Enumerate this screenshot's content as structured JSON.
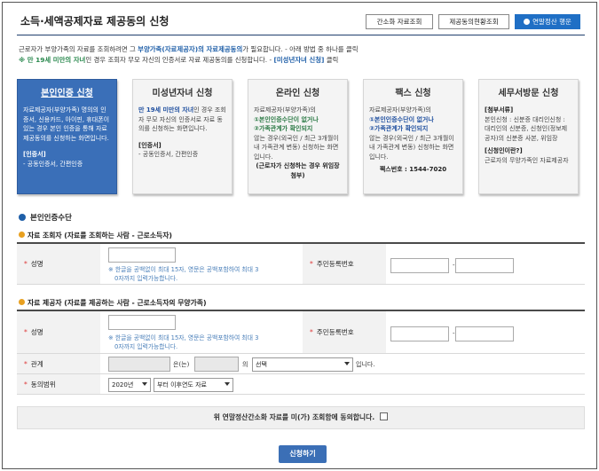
{
  "page": {
    "title": "소득·세액공제자료 제공동의 신청",
    "buttons": {
      "deduction_lookup": "간소화 자료조회",
      "consent_status": "제공동의현황조회",
      "yearend_help": "연말정산 행운"
    },
    "intro_line1_pre": "근로자가 부양가족의 자료를 조회하려면 그 ",
    "intro_line1_hl": "부양가족(자료제공자)의 자료제공동의",
    "intro_line1_post": "가 필요합니다. - 아래 방법 중 하나를 클릭",
    "intro_line2_green": "※ 만 19세 미만의 자녀",
    "intro_line2_mid": "인 경우 조회자 무모 자신의 인증서로 자료 제공동의를 신청합니다. - ",
    "intro_line2_hl": "[미성년자녀 신청]",
    "intro_line2_post": " 클릭"
  },
  "cards": [
    {
      "title": "본인인증 신청",
      "body": "자료제공자(부양가족) 명의의 인증서, 신용카드, 아이핀, 휴대폰이 있는 경우 본인 인증을 통해 자료제공동의를 신청하는 화면입니다.",
      "footer_title": "[인증서]",
      "footer_body": "- 공동인증서, 간편인증"
    },
    {
      "title": "미성년자녀 신청",
      "body_hl": "만 19세 미만의 자녀",
      "body": "인 경우 조회자 무모 자신의 인증서로 자료 동의를 신청하는 화면입니다.",
      "footer_title": "[인증서]",
      "footer_body": "- 공동인증서, 간편인증"
    },
    {
      "title": "온라인 신청",
      "body_pre": "자료제공자(부양가족)의",
      "body_b1": "①본인인증수단이 없거나",
      "body_b2": "②가족관계가 확인되지",
      "body_mid": "않는 경우(외국인 / 최근 3개월이내 가족관계 변동) 신청하는 화면입니다.",
      "footer": "(근로자가 신청하는 경우 위임장 첨부)"
    },
    {
      "title": "팩스 신청",
      "body_pre": "자료제공자(부양가족)의",
      "body_b1": "①본인인증수단이 없거나",
      "body_b2": "②가족관계가 확인되지",
      "body_mid": "않는 경우(외국인 / 최근 3개월이내 가족관계 변동) 신청하는 화면입니다.",
      "footer": "팩스번호 : 1544-7020"
    },
    {
      "title": "세무서방문 신청",
      "doc_title": "[첨부서류]",
      "doc_body": "본인신청 : 신분증 대리인신청 : 대리인의 신분증, 신청인(정보제공자)의 신분증 사본, 위임장",
      "who_title": "[신청인이란?]",
      "who_body": "근로자의 무양가족인 자료제공자"
    }
  ],
  "section": {
    "title": "본인인증수단",
    "viewer_title": "자료 조회자 (자료를 조회하는 사람 - 근로소득자)",
    "provider_title": "자료 제공자 (자료를 제공하는 사람 - 근로소득자의 무양가족)"
  },
  "form": {
    "name_label": "성명",
    "rrn_label": "주민등록번호",
    "name_hint_line1": "※ 한글을 공백없이 최대 15자, 영문은 공백포함하여 최대 3",
    "name_hint_line2": "0자까지 입력가능합니다.",
    "rrn_dash": "-",
    "relation_label": "관계",
    "relation_eun": "은(는)",
    "relation_ui": "의",
    "relation_select": "선택",
    "relation_end": "입니다.",
    "consent_range_label": "동의범위",
    "year_select": "2020년",
    "range_select": "부터 이후연도 자료"
  },
  "agreement": {
    "text": "위 연말정산간소화 자료를 미(가) 조회함에 동의합니다."
  },
  "submit": {
    "label": "신청하기"
  },
  "colors": {
    "primary": "#3a6fb8",
    "accent_green": "#2c8a50",
    "required_star": "#d33333"
  }
}
